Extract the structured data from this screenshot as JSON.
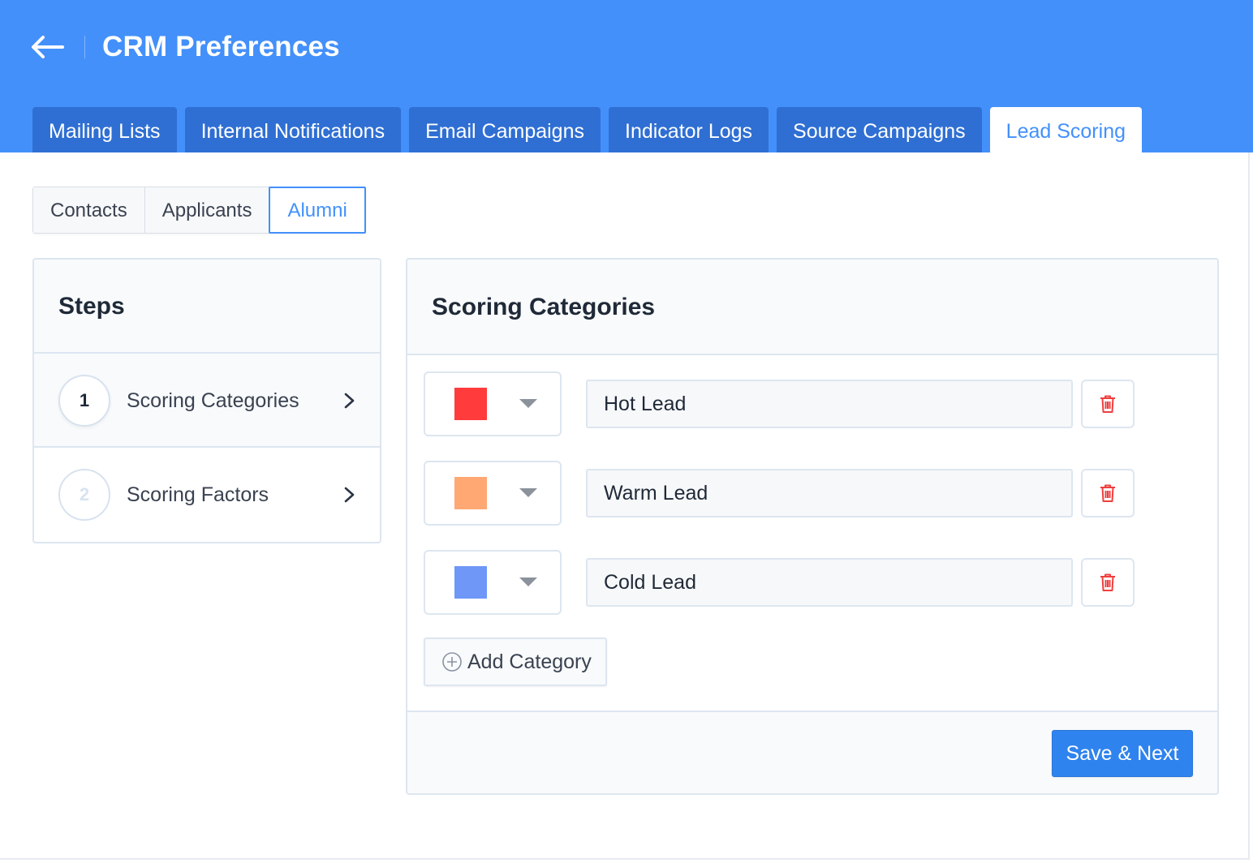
{
  "header": {
    "title": "CRM Preferences",
    "back_icon": "arrow-left-icon",
    "background_color": "#4390fb"
  },
  "tabs": [
    {
      "label": "Mailing Lists",
      "active": false
    },
    {
      "label": "Internal Notifications",
      "active": false
    },
    {
      "label": "Email Campaigns",
      "active": false
    },
    {
      "label": "Indicator Logs",
      "active": false
    },
    {
      "label": "Source Campaigns",
      "active": false
    },
    {
      "label": "Lead Scoring",
      "active": true
    }
  ],
  "segments": [
    {
      "label": "Contacts",
      "active": false
    },
    {
      "label": "Applicants",
      "active": false
    },
    {
      "label": "Alumni",
      "active": true
    }
  ],
  "steps": {
    "title": "Steps",
    "items": [
      {
        "number": "1",
        "label": "Scoring Categories",
        "current": true,
        "icon": "chevron-right-icon"
      },
      {
        "number": "2",
        "label": "Scoring Factors",
        "current": false,
        "icon": "chevron-right-icon"
      }
    ]
  },
  "categories": {
    "title": "Scoring Categories",
    "items": [
      {
        "name": "Hot Lead",
        "color": "#ff3b3b"
      },
      {
        "name": "Warm Lead",
        "color": "#ffa874"
      },
      {
        "name": "Cold Lead",
        "color": "#6e97f7"
      }
    ],
    "add_label": "Add Category",
    "save_label": "Save & Next",
    "delete_icon": "trash-icon",
    "add_icon": "plus-circle-icon"
  }
}
